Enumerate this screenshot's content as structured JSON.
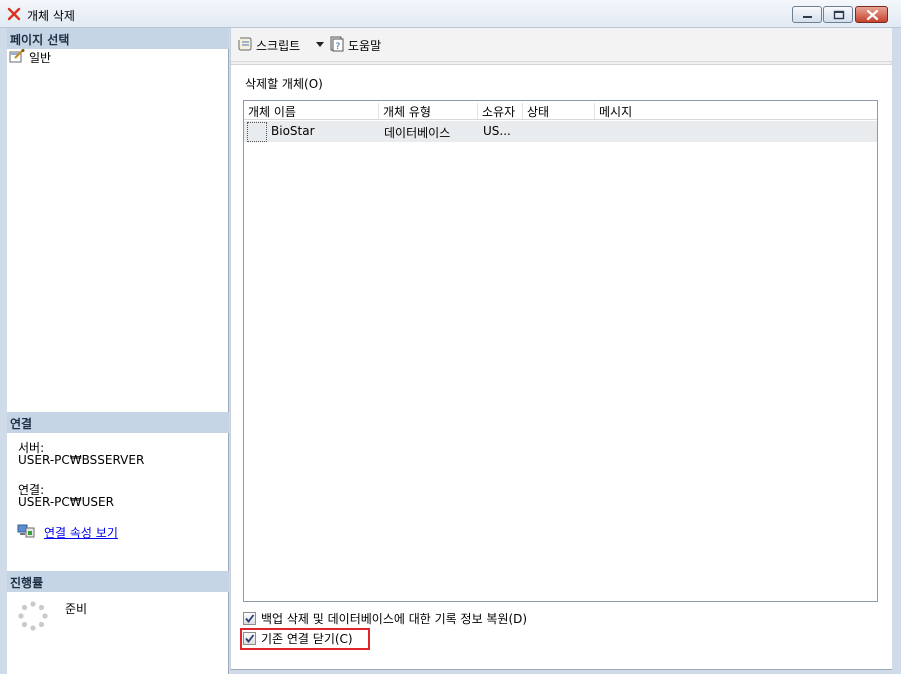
{
  "window": {
    "title": "개체 삭제"
  },
  "left_panel": {
    "select_page_header": "페이지 선택",
    "nav_items": [
      {
        "label": "일반",
        "icon": "page-wrench-icon"
      }
    ],
    "connection_header": "연결",
    "server_label": "서버:",
    "server_value": "USER-PC₩BSSERVER",
    "connection_label": "연결:",
    "connection_value": "USER-PC₩USER",
    "view_props_link": "연결 속성 보기",
    "progress_header": "진행률",
    "progress_status": "준비"
  },
  "toolbar": {
    "script_label": "스크립트",
    "help_label": "도움말"
  },
  "main": {
    "objects_label": "삭제할 개체(O)",
    "columns": [
      "개체 이름",
      "개체 유형",
      "소유자",
      "상태",
      "메시지"
    ],
    "rows": [
      {
        "name": "BioStar",
        "type": "데이터베이스",
        "owner": "US...",
        "status": "",
        "message": ""
      }
    ],
    "option_backup_history": "백업 삭제 및 데이터베이스에 대한 기록 정보 복원(D)",
    "option_backup_history_checked": true,
    "option_close_connections": "기존 연결 닫기(C)",
    "option_close_connections_checked": true
  },
  "colors": {
    "title_icon_red": "#d9331f",
    "section_header_bg": "#c5d5e6",
    "link_blue": "#0000ee",
    "highlight_red": "#e0262a"
  }
}
